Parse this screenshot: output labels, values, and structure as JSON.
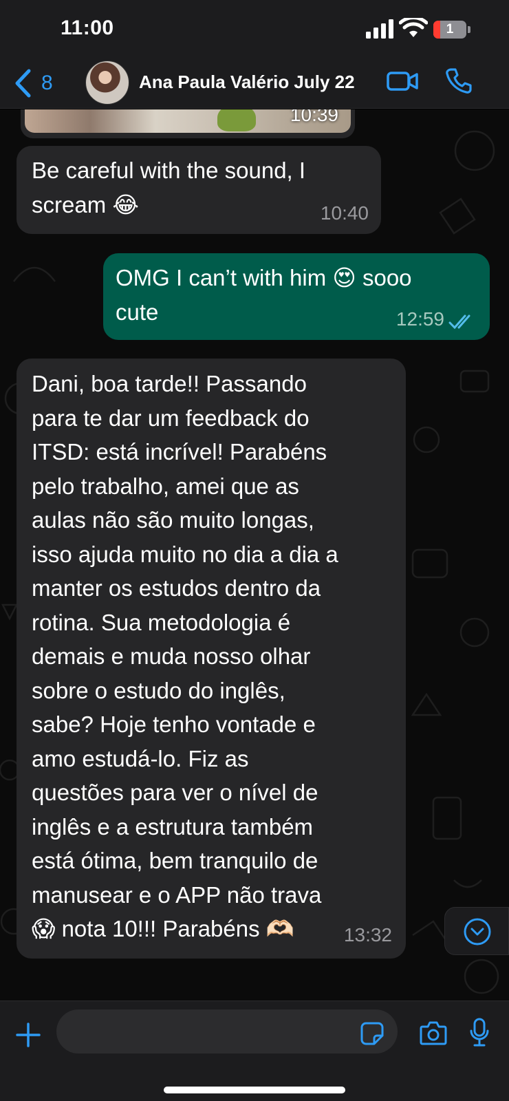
{
  "status_bar": {
    "time": "11:00",
    "battery_level": "1",
    "icons": [
      "signal-icon",
      "wifi-icon",
      "battery-icon"
    ]
  },
  "header": {
    "back_count": "8",
    "contact_name": "Ana Paula Valério July 22",
    "icons": [
      "chevron-left-icon",
      "video-call-icon",
      "phone-icon"
    ],
    "accent_color": "#2e9bf5"
  },
  "messages": [
    {
      "direction": "incoming",
      "type": "media",
      "time": "10:39"
    },
    {
      "direction": "incoming",
      "type": "text",
      "text": "Be careful with the sound, I\nscream 😂",
      "time": "10:40"
    },
    {
      "direction": "outgoing",
      "type": "text",
      "text": "OMG I can’t with him 😍 sooo\ncute",
      "time": "12:59",
      "status": "read"
    },
    {
      "direction": "incoming",
      "type": "text",
      "text": "Dani, boa tarde!! Passando\npara te dar um feedback do\nITSD: está incrível! Parabéns\npelo trabalho, amei que as\naulas não são muito longas,\nisso ajuda muito no dia a dia a\nmanter os estudos dentro da\nrotina. Sua metodologia é\ndemais e muda nosso olhar\nsobre o estudo do inglês,\nsabe? Hoje tenho vontade e\namo estudá-lo. Fiz as\nquestões para ver o nível de\ninglês e a estrutura também\nestá ótima, bem tranquilo de\nmanusear e o APP não trava\n😱 nota 10!!! Parabéns 🫶🏻",
      "time": "13:32"
    }
  ],
  "input_bar": {
    "placeholder": "",
    "icons": [
      "plus-icon",
      "sticker-icon",
      "camera-icon",
      "microphone-icon"
    ]
  },
  "colors": {
    "incoming_bubble": "#262628",
    "outgoing_bubble": "#005c4b",
    "read_ticks": "#53bdeb",
    "bar_background": "#1c1c1e"
  }
}
